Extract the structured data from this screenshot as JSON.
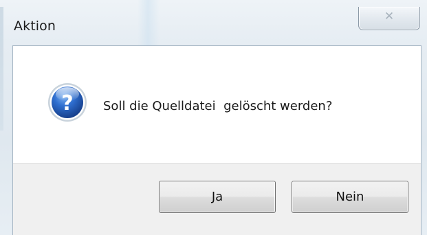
{
  "window": {
    "title": "Aktion",
    "close_glyph": "✕"
  },
  "dialog": {
    "icon": "question-icon",
    "message": "Soll die Quelldatei  gelöscht werden?"
  },
  "buttons": {
    "yes_label": "Ja",
    "no_label": "Nein"
  },
  "colors": {
    "icon_blue": "#1f5fb8",
    "footer_bg": "#f0f0f0"
  }
}
